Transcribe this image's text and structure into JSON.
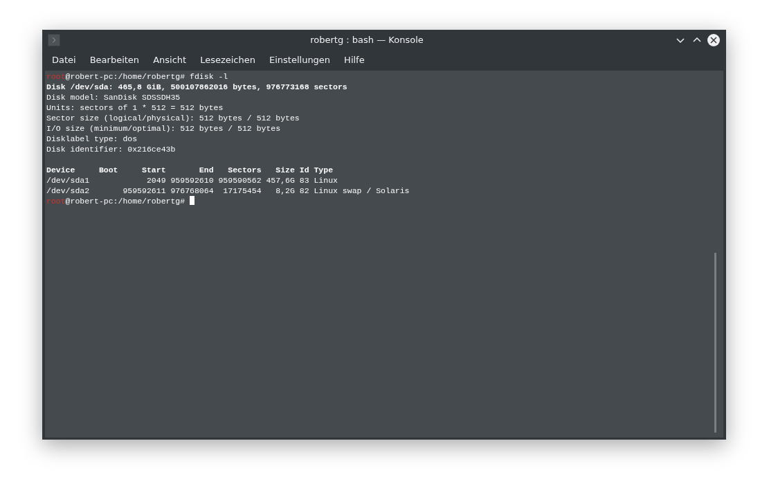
{
  "window": {
    "title": "robertg : bash — Konsole"
  },
  "menu": [
    "Datei",
    "Bearbeiten",
    "Ansicht",
    "Lesezeichen",
    "Einstellungen",
    "Hilfe"
  ],
  "terminal": {
    "lines": [
      {
        "kind": "prompt",
        "user": "root",
        "host_path": "@robert-pc:/home/robertg#",
        "command": "fdisk -l",
        "cursor": false
      },
      {
        "kind": "bold",
        "text": "Disk /dev/sda: 465,8 GiB, 500107862016 bytes, 976773168 sectors"
      },
      {
        "kind": "plain",
        "text": "Disk model: SanDisk SDSSDH35"
      },
      {
        "kind": "plain",
        "text": "Units: sectors of 1 * 512 = 512 bytes"
      },
      {
        "kind": "plain",
        "text": "Sector size (logical/physical): 512 bytes / 512 bytes"
      },
      {
        "kind": "plain",
        "text": "I/O size (minimum/optimal): 512 bytes / 512 bytes"
      },
      {
        "kind": "plain",
        "text": "Disklabel type: dos"
      },
      {
        "kind": "plain",
        "text": "Disk identifier: 0x216ce43b"
      },
      {
        "kind": "blank"
      },
      {
        "kind": "bold",
        "text": "Device     Boot     Start       End   Sectors   Size Id Type"
      },
      {
        "kind": "plain",
        "text": "/dev/sda1            2049 959592610 959590562 457,6G 83 Linux"
      },
      {
        "kind": "plain",
        "text": "/dev/sda2       959592611 976768064  17175454   8,2G 82 Linux swap / Solaris"
      },
      {
        "kind": "prompt",
        "user": "root",
        "host_path": "@robert-pc:/home/robertg#",
        "cursor": true
      }
    ]
  }
}
